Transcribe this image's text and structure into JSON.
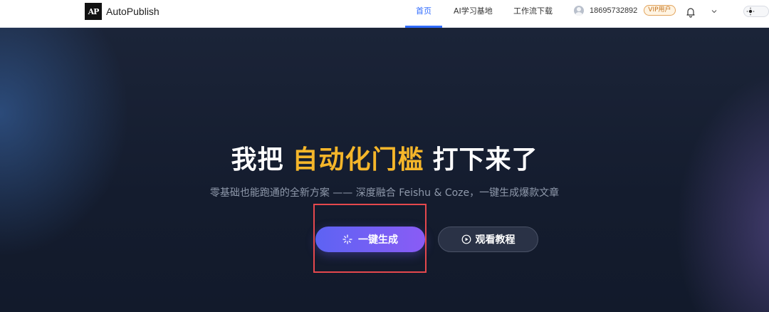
{
  "app": {
    "logo_mark": "AP",
    "name": "AutoPublish"
  },
  "nav": {
    "items": [
      {
        "label": "首页",
        "active": true
      },
      {
        "label": "AI学习基地",
        "active": false
      },
      {
        "label": "工作流下载",
        "active": false
      }
    ]
  },
  "user": {
    "phone": "18695732892",
    "badge": "VIP用户",
    "icons": [
      "user-avatar-icon",
      "bell-icon",
      "chevron-down-icon",
      "sun-icon"
    ]
  },
  "hero": {
    "title_part1": "我把",
    "title_highlight": "自动化门槛",
    "title_part2": "打下来了",
    "subtitle": "零基础也能跑通的全新方案 —— 深度融合 Feishu & Coze，一键生成爆款文章",
    "primary_button": "一键生成",
    "secondary_button": "观看教程"
  },
  "colors": {
    "accent": "#2f6bff",
    "highlight": "#f5b62a",
    "button_gradient_start": "#5d63f3",
    "button_gradient_end": "#8a5cf5",
    "annotation_box": "#e5484d"
  }
}
